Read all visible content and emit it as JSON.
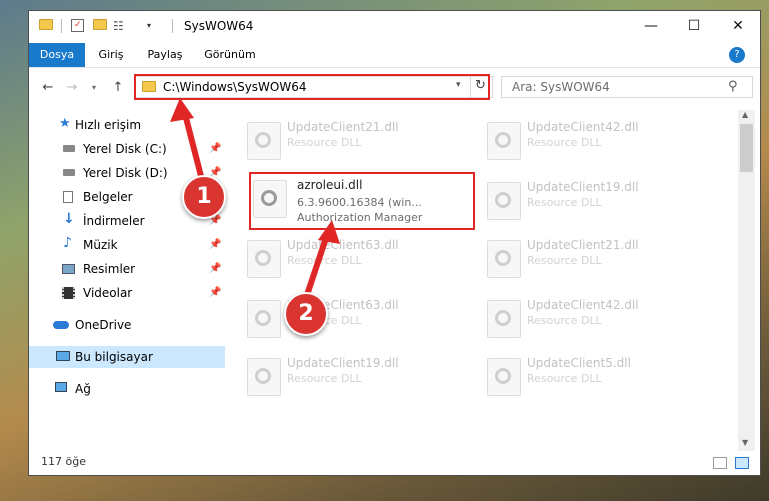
{
  "window": {
    "title": "SysWOW64"
  },
  "ribbon": {
    "tabs": [
      "Dosya",
      "Giriş",
      "Paylaş",
      "Görünüm"
    ]
  },
  "address": {
    "path": "C:\\Windows\\SysWOW64"
  },
  "search": {
    "placeholder": "Ara: SysWOW64"
  },
  "sidebar": {
    "items": [
      {
        "label": "Hızlı erişim",
        "icon": "star-icon"
      },
      {
        "label": "Yerel Disk (C:)",
        "icon": "drive-icon",
        "pinned": true
      },
      {
        "label": "Yerel Disk (D:)",
        "icon": "drive-icon",
        "pinned": true
      },
      {
        "label": "Belgeler",
        "icon": "documents-icon",
        "pinned": true
      },
      {
        "label": "İndirmeler",
        "icon": "download-icon",
        "pinned": true
      },
      {
        "label": "Müzik",
        "icon": "music-icon",
        "pinned": true
      },
      {
        "label": "Resimler",
        "icon": "pictures-icon",
        "pinned": true
      },
      {
        "label": "Videolar",
        "icon": "video-icon",
        "pinned": true
      },
      {
        "label": "OneDrive",
        "icon": "cloud-icon"
      },
      {
        "label": "Bu bilgisayar",
        "icon": "computer-icon",
        "selected": true
      },
      {
        "label": "Ağ",
        "icon": "network-icon"
      }
    ]
  },
  "files": {
    "highlight": {
      "name": "azroleui.dll",
      "version": "6.3.9600.16384 (win...",
      "description": "Authorization Manager"
    },
    "col1": [
      {
        "name": "UpdateClient21.dll",
        "type": "Resource DLL"
      },
      {
        "name": "UpdateClient63.dll",
        "type": "Resource DLL"
      },
      {
        "name": "UpdateClient63.dll",
        "type": "Resource DLL"
      },
      {
        "name": "UpdateClient19.dll",
        "type": "Resource DLL"
      }
    ],
    "col2": [
      {
        "name": "UpdateClient42.dll",
        "type": "Resource DLL"
      },
      {
        "name": "UpdateClient19.dll",
        "type": "Resource DLL"
      },
      {
        "name": "UpdateClient21.dll",
        "type": "Resource DLL"
      },
      {
        "name": "UpdateClient42.dll",
        "type": "Resource DLL"
      },
      {
        "name": "UpdateClient5.dll",
        "type": "Resource DLL"
      }
    ]
  },
  "status": {
    "count": "117 öğe"
  },
  "callouts": {
    "one": "1",
    "two": "2"
  },
  "colors": {
    "accent": "#1979ca",
    "callout": "#d9342f"
  }
}
